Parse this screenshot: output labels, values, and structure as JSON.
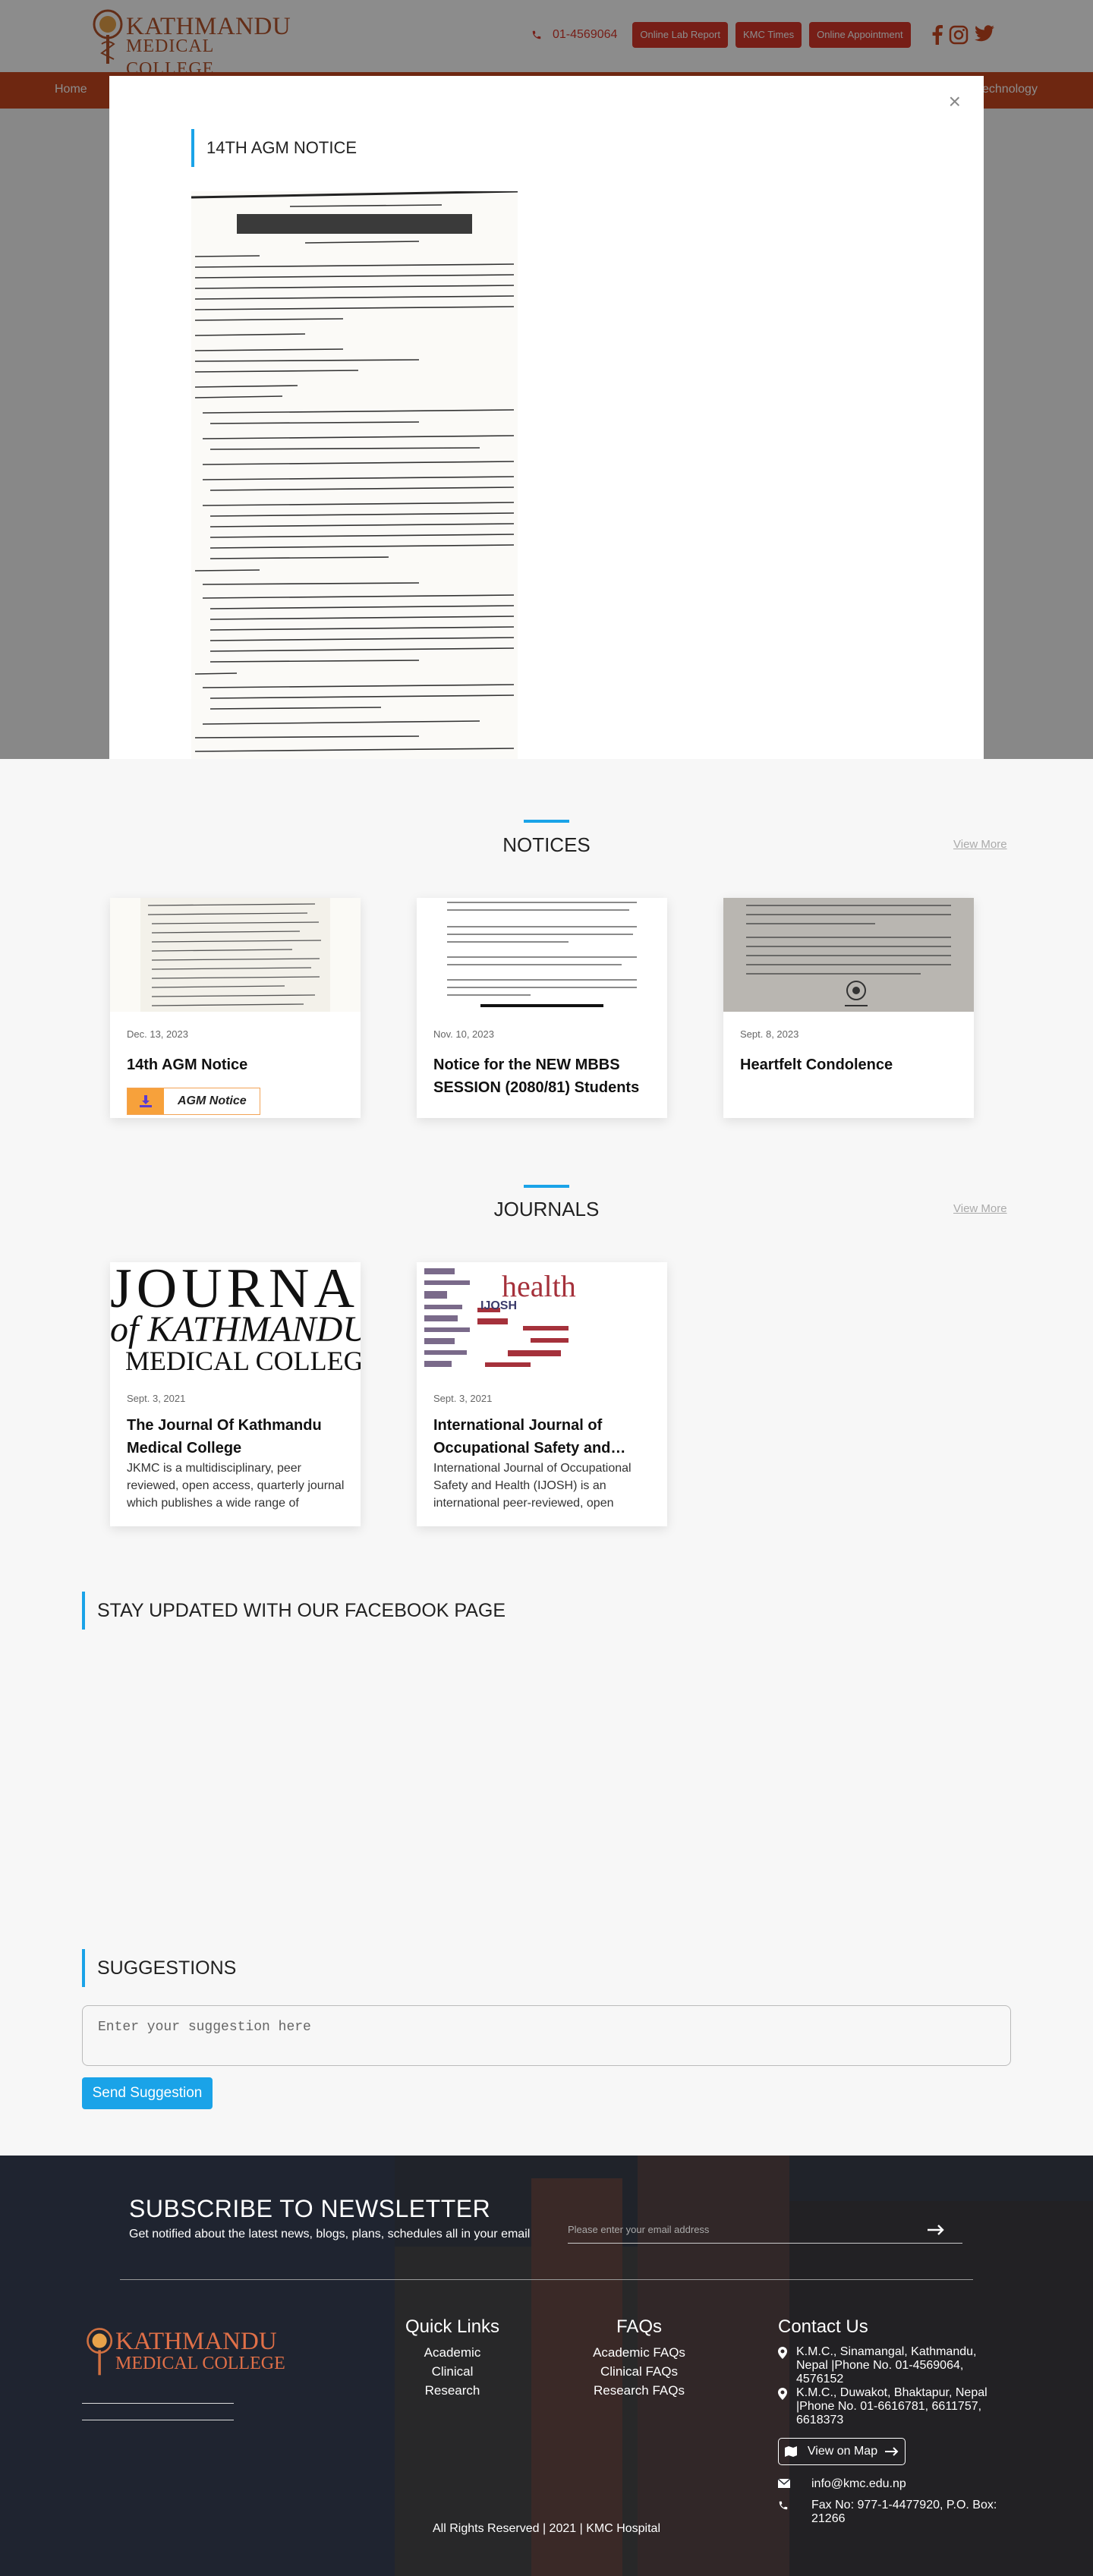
{
  "header": {
    "logo_line1": "KATHMANDU",
    "logo_line2": "MEDICAL COLLEGE",
    "phone": "01-4569064",
    "buttons": [
      "Online Lab Report",
      "KMC Times",
      "Online Appointment"
    ],
    "social": [
      "facebook-icon",
      "instagram-icon",
      "twitter-icon"
    ],
    "accent": "#d9382b"
  },
  "nav": {
    "items": [
      "Home",
      "Technology"
    ],
    "color": "#c9471f"
  },
  "modal": {
    "title": "14TH AGM NOTICE",
    "close": "×"
  },
  "notices": {
    "title": "NOTICES",
    "view_more": "View More",
    "cards": [
      {
        "date": "Dec. 13, 2023",
        "title": "14th AGM Notice",
        "attachment": "AGM Notice"
      },
      {
        "date": "Nov. 10, 2023",
        "title": "Notice for the NEW MBBS SESSION (2080/81) Students"
      },
      {
        "date": "Sept. 8, 2023",
        "title": "Heartfelt Condolence"
      }
    ]
  },
  "journals": {
    "title": "JOURNALS",
    "view_more": "View More",
    "cards": [
      {
        "date": "Sept. 3, 2021",
        "title": "The Journal Of Kathmandu Medical College",
        "desc": "JKMC is a multidisciplinary, peer reviewed, open access, quarterly journal which publishes a wide range of scientific work…",
        "img_l1": "JOURNAL",
        "img_l2": "of KATHMANDU",
        "img_l3": "MEDICAL COLLEGE"
      },
      {
        "date": "Sept. 3, 2021",
        "title": "International Journal of Occupational Safety and…",
        "desc": "International Journal of Occupational Safety and Health (IJOSH) is an international peer-reviewed, open acces…",
        "img_word": "health",
        "img_word2": "IJOSH"
      }
    ]
  },
  "facebook": {
    "title": "STAY UPDATED WITH OUR FACEBOOK PAGE"
  },
  "suggestions": {
    "title": "SUGGESTIONS",
    "placeholder": "Enter your suggestion here",
    "button": "Send Suggestion"
  },
  "footer": {
    "subscribe_title": "SUBSCRIBE TO NEWSLETTER",
    "subscribe_text": "Get notified about the latest news, blogs, plans, schedules all in your email",
    "email_placeholder": "Please enter your email address",
    "logo_line1": "KATHMANDU",
    "logo_line2": "MEDICAL COLLEGE",
    "quick_links_title": "Quick Links",
    "quick_links": [
      "Academic",
      "Clinical",
      "Research"
    ],
    "faqs_title": "FAQs",
    "faqs": [
      "Academic FAQs",
      "Clinical FAQs",
      "Research FAQs"
    ],
    "contact_title": "Contact Us",
    "address1": "K.M.C., Sinamangal, Kathmandu, Nepal |Phone No. 01-4569064, 4576152",
    "address2": "K.M.C., Duwakot, Bhaktapur, Nepal |Phone No. 01-6616781, 6611757, 6618373",
    "map_button": "View on Map",
    "email": "info@kmc.edu.np",
    "fax": "Fax No: 977-1-4477920, P.O. Box: 21266",
    "copyright": "All Rights Reserved | 2021 | KMC Hospital"
  }
}
